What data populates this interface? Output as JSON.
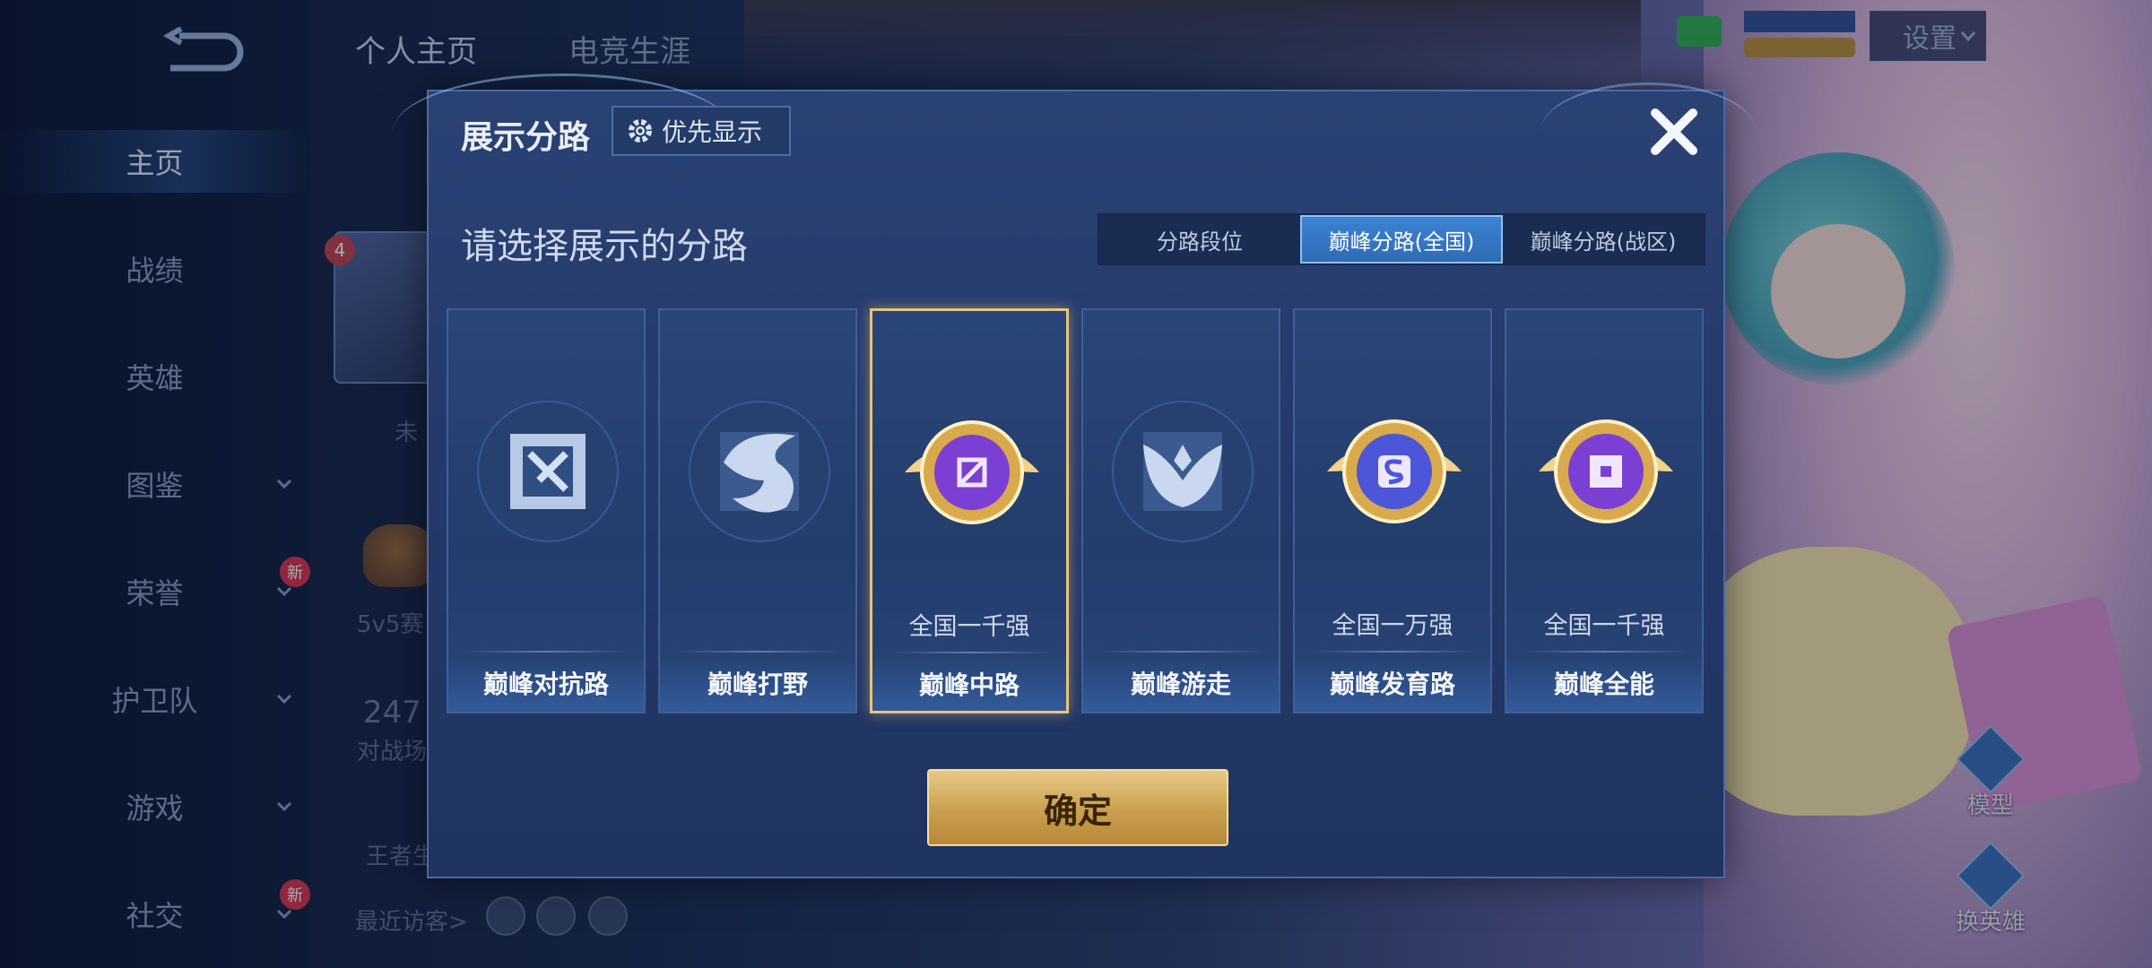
{
  "sidebar": {
    "items": [
      {
        "label": "主页",
        "active": true
      },
      {
        "label": "战绩"
      },
      {
        "label": "英雄"
      },
      {
        "label": "图鉴"
      },
      {
        "label": "荣誉"
      },
      {
        "label": "护卫队"
      },
      {
        "label": "游戏"
      },
      {
        "label": "社交"
      }
    ],
    "new_badge": "新"
  },
  "header": {
    "tabs": [
      "个人主页",
      "电竞生涯"
    ],
    "settings_label": "设置"
  },
  "profile": {
    "badge_number": "4",
    "status_text": "未",
    "rank_caption": "5v5赛",
    "stat_number": "247",
    "stat_caption": "对战场",
    "king_caption": "王者生",
    "recent_visitors": "最近访客>"
  },
  "right_panel": {
    "model_label": "模型",
    "swap_hero_label": "换英雄"
  },
  "modal": {
    "title": "展示分路",
    "priority_label": "优先显示",
    "subtitle": "请选择展示的分路",
    "tabs": [
      "分路段位",
      "巅峰分路(全国)",
      "巅峰分路(战区)"
    ],
    "active_tab": "巅峰分路(全国)",
    "cards": [
      {
        "lane": "巅峰对抗路",
        "rank": "",
        "icon": "sword-lane-icon",
        "emblem": "plain"
      },
      {
        "lane": "巅峰打野",
        "rank": "",
        "icon": "dragon-jungle-icon",
        "emblem": "plain"
      },
      {
        "lane": "巅峰中路",
        "rank": "全国一千强",
        "icon": "mid-lane-gold-icon",
        "emblem": "gold",
        "selected": true
      },
      {
        "lane": "巅峰游走",
        "rank": "",
        "icon": "wings-roam-icon",
        "emblem": "plain"
      },
      {
        "lane": "巅峰发育路",
        "rank": "全国一万强",
        "icon": "carry-lane-gold-icon",
        "emblem": "gold"
      },
      {
        "lane": "巅峰全能",
        "rank": "全国一千强",
        "icon": "all-round-gold-icon",
        "emblem": "gold"
      }
    ],
    "confirm_label": "确定"
  },
  "colors": {
    "accent_blue": "#3c83d3",
    "gold": "#e8c37a",
    "emblem_purple": "#7b3fd3"
  }
}
